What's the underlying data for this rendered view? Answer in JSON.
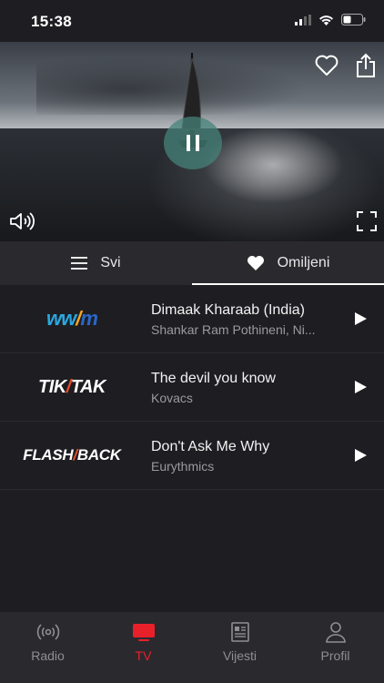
{
  "status_bar": {
    "time": "15:38"
  },
  "video": {
    "icons": [
      "heart-outline-icon",
      "share-icon",
      "pause-icon",
      "volume-icon",
      "fullscreen-icon"
    ]
  },
  "tabs": [
    {
      "label": "Svi",
      "icon": "menu-icon",
      "active": false
    },
    {
      "label": "Omiljeni",
      "icon": "heart-icon",
      "active": true
    }
  ],
  "stations": [
    {
      "logo": "WWM",
      "title": "Dimaak Kharaab (India)",
      "subtitle": "Shankar Ram Pothineni, Ni..."
    },
    {
      "logo": "TIKTAK",
      "title": "The devil you know",
      "subtitle": "Kovacs"
    },
    {
      "logo": "FLASHBACK",
      "title": "Don't Ask Me Why",
      "subtitle": "Eurythmics"
    }
  ],
  "nav": [
    {
      "label": "Radio",
      "icon": "radio-icon"
    },
    {
      "label": "TV",
      "icon": "tv-icon",
      "active": true
    },
    {
      "label": "Vijesti",
      "icon": "news-icon"
    },
    {
      "label": "Profil",
      "icon": "profile-icon"
    }
  ],
  "colors": {
    "accent": "#e8202a",
    "background": "#1e1e22",
    "surface": "#2a2a2e"
  }
}
